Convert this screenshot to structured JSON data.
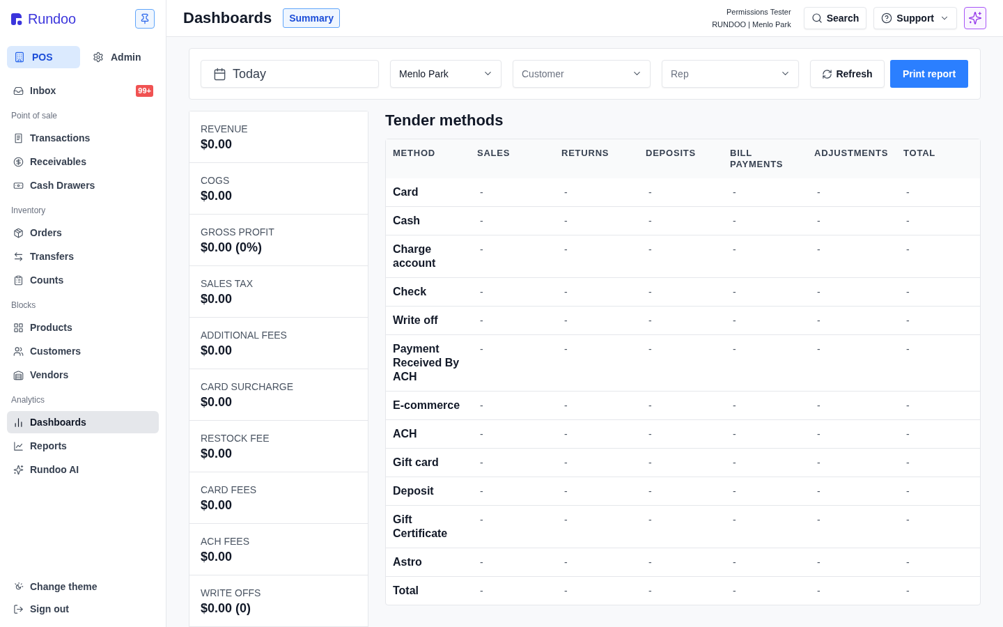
{
  "sidebar": {
    "brand": "Rundoo",
    "modes": [
      {
        "label": "POS",
        "selected": true
      },
      {
        "label": "Admin",
        "selected": false
      }
    ],
    "inbox": {
      "label": "Inbox",
      "badge": "99+",
      "selected": false
    },
    "sections": [
      {
        "title": "Point of sale",
        "items": [
          {
            "label": "Transactions",
            "selected": false
          },
          {
            "label": "Receivables",
            "selected": false
          },
          {
            "label": "Cash Drawers",
            "selected": false
          }
        ]
      },
      {
        "title": "Inventory",
        "items": [
          {
            "label": "Orders",
            "selected": false
          },
          {
            "label": "Transfers",
            "selected": false
          },
          {
            "label": "Counts",
            "selected": false
          }
        ]
      },
      {
        "title": "Blocks",
        "items": [
          {
            "label": "Products",
            "selected": false
          },
          {
            "label": "Customers",
            "selected": false
          },
          {
            "label": "Vendors",
            "selected": false
          }
        ]
      },
      {
        "title": "Analytics",
        "items": [
          {
            "label": "Dashboards",
            "selected": true
          },
          {
            "label": "Reports",
            "selected": false
          },
          {
            "label": "Rundoo AI",
            "selected": false
          }
        ]
      }
    ],
    "footer_items": [
      {
        "label": "Change theme"
      },
      {
        "label": "Sign out"
      }
    ]
  },
  "header": {
    "title": "Dashboards",
    "view": "Summary",
    "user": {
      "name": "Permissions Tester",
      "organization": "RUNDOO | Menlo Park"
    },
    "search_button": "Search",
    "support_button": "Support"
  },
  "filters": {
    "date_range": "Today",
    "location": {
      "value": "Menlo Park"
    },
    "customer": {
      "placeholder": "Customer"
    },
    "rep": {
      "placeholder": "Rep"
    },
    "refresh_button": "Refresh",
    "print_button": "Print report"
  },
  "stats": [
    {
      "label": "REVENUE",
      "value": "$0.00"
    },
    {
      "label": "COGS",
      "value": "$0.00"
    },
    {
      "label": "GROSS PROFIT",
      "value": "$0.00 (0%)"
    },
    {
      "label": "SALES TAX",
      "value": "$0.00"
    },
    {
      "label": "ADDITIONAL FEES",
      "value": "$0.00"
    },
    {
      "label": "CARD SURCHARGE",
      "value": "$0.00"
    },
    {
      "label": "RESTOCK FEE",
      "value": "$0.00"
    },
    {
      "label": "CARD FEES",
      "value": "$0.00"
    },
    {
      "label": "ACH FEES",
      "value": "$0.00"
    },
    {
      "label": "WRITE OFFS",
      "value": "$0.00 (0)"
    }
  ],
  "tender_methods": {
    "title": "Tender methods",
    "columns": [
      "METHOD",
      "SALES",
      "RETURNS",
      "DEPOSITS",
      "BILL PAYMENTS",
      "ADJUSTMENTS",
      "TOTAL"
    ],
    "rows": [
      {
        "method": "Card",
        "values": [
          "-",
          "-",
          "-",
          "-",
          "-",
          "-"
        ]
      },
      {
        "method": "Cash",
        "values": [
          "-",
          "-",
          "-",
          "-",
          "-",
          "-"
        ]
      },
      {
        "method": "Charge account",
        "values": [
          "-",
          "-",
          "-",
          "-",
          "-",
          "-"
        ]
      },
      {
        "method": "Check",
        "values": [
          "-",
          "-",
          "-",
          "-",
          "-",
          "-"
        ]
      },
      {
        "method": "Write off",
        "values": [
          "-",
          "-",
          "-",
          "-",
          "-",
          "-"
        ]
      },
      {
        "method": "Payment Received By ACH",
        "values": [
          "-",
          "-",
          "-",
          "-",
          "-",
          "-"
        ]
      },
      {
        "method": "E-commerce",
        "values": [
          "-",
          "-",
          "-",
          "-",
          "-",
          "-"
        ]
      },
      {
        "method": "ACH",
        "values": [
          "-",
          "-",
          "-",
          "-",
          "-",
          "-"
        ]
      },
      {
        "method": "Gift card",
        "values": [
          "-",
          "-",
          "-",
          "-",
          "-",
          "-"
        ]
      },
      {
        "method": "Deposit",
        "values": [
          "-",
          "-",
          "-",
          "-",
          "-",
          "-"
        ]
      },
      {
        "method": "Gift Certificate",
        "values": [
          "-",
          "-",
          "-",
          "-",
          "-",
          "-"
        ]
      },
      {
        "method": "Astro",
        "values": [
          "-",
          "-",
          "-",
          "-",
          "-",
          "-"
        ]
      },
      {
        "method": "Total",
        "values": [
          "-",
          "-",
          "-",
          "-",
          "-",
          "-"
        ]
      }
    ]
  }
}
